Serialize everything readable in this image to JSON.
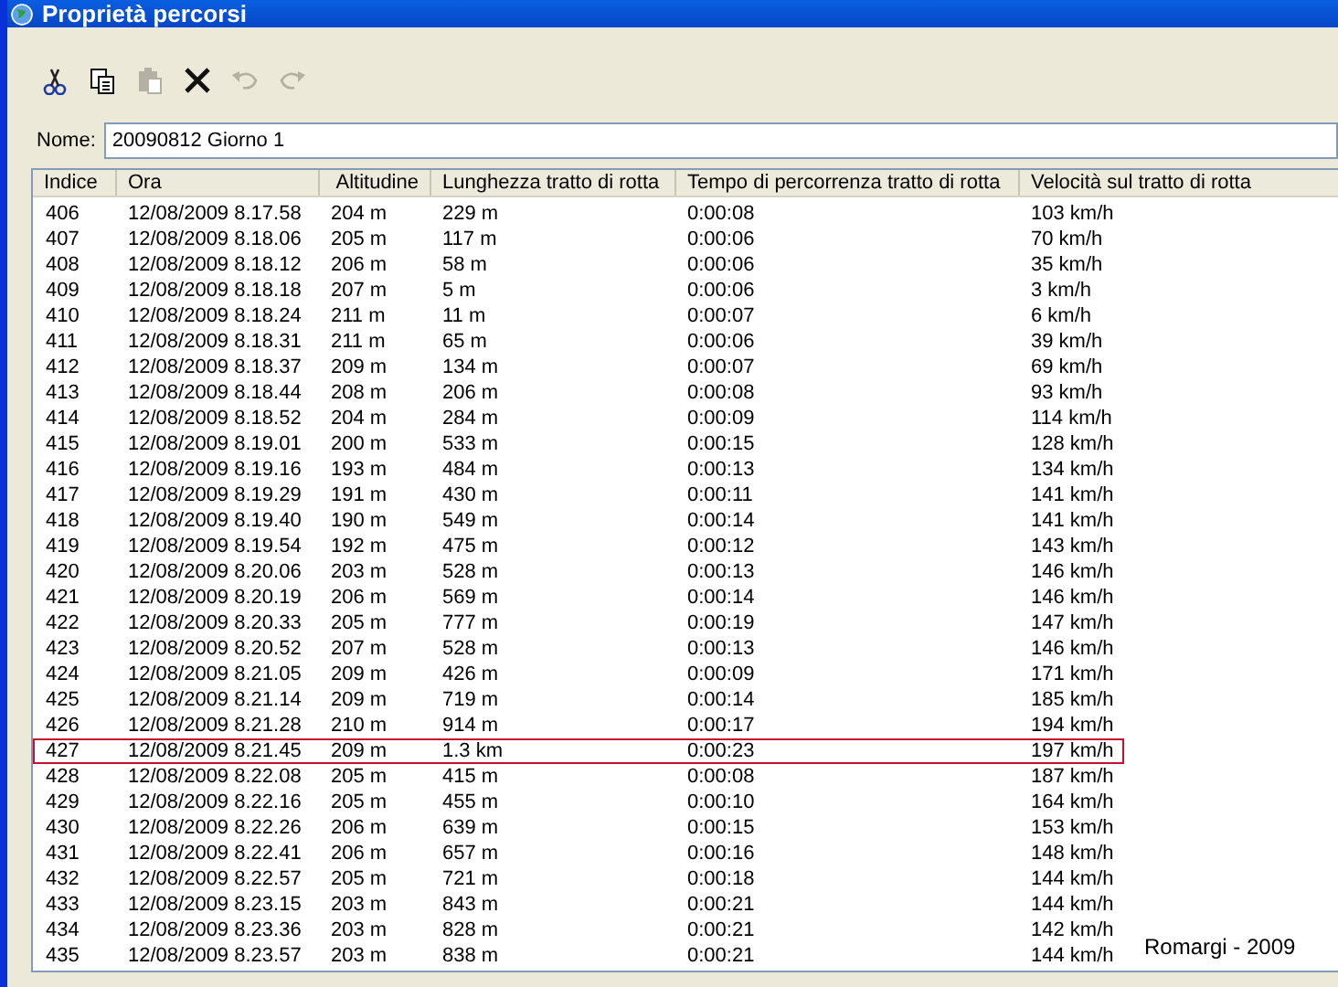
{
  "window": {
    "title": "Proprietà percorsi"
  },
  "toolbar": [
    {
      "kind": "cut",
      "disabled": false
    },
    {
      "kind": "copy",
      "disabled": false
    },
    {
      "kind": "paste",
      "disabled": true
    },
    {
      "kind": "delete",
      "disabled": false
    },
    {
      "kind": "undo",
      "disabled": true
    },
    {
      "kind": "redo",
      "disabled": true
    }
  ],
  "name_field": {
    "label": "Nome:",
    "value": "20090812 Giorno 1"
  },
  "table": {
    "columns": [
      "Indice",
      "Ora",
      "Altitudine",
      "Lunghezza tratto di rotta",
      "Tempo di percorrenza tratto di rotta",
      "Velocità sul tratto di rotta"
    ],
    "rows": [
      {
        "cells": [
          "406",
          "12/08/2009 8.17.58",
          "204 m",
          "229 m",
          "0:00:08",
          "103 km/h"
        ],
        "highlighted": false
      },
      {
        "cells": [
          "407",
          "12/08/2009 8.18.06",
          "205 m",
          "117 m",
          "0:00:06",
          "70 km/h"
        ],
        "highlighted": false
      },
      {
        "cells": [
          "408",
          "12/08/2009 8.18.12",
          "206 m",
          "58 m",
          "0:00:06",
          "35 km/h"
        ],
        "highlighted": false
      },
      {
        "cells": [
          "409",
          "12/08/2009 8.18.18",
          "207 m",
          "5 m",
          "0:00:06",
          "3 km/h"
        ],
        "highlighted": false
      },
      {
        "cells": [
          "410",
          "12/08/2009 8.18.24",
          "211 m",
          "11 m",
          "0:00:07",
          "6 km/h"
        ],
        "highlighted": false
      },
      {
        "cells": [
          "411",
          "12/08/2009 8.18.31",
          "211 m",
          "65 m",
          "0:00:06",
          "39 km/h"
        ],
        "highlighted": false
      },
      {
        "cells": [
          "412",
          "12/08/2009 8.18.37",
          "209 m",
          "134 m",
          "0:00:07",
          "69 km/h"
        ],
        "highlighted": false
      },
      {
        "cells": [
          "413",
          "12/08/2009 8.18.44",
          "208 m",
          "206 m",
          "0:00:08",
          "93 km/h"
        ],
        "highlighted": false
      },
      {
        "cells": [
          "414",
          "12/08/2009 8.18.52",
          "204 m",
          "284 m",
          "0:00:09",
          "114 km/h"
        ],
        "highlighted": false
      },
      {
        "cells": [
          "415",
          "12/08/2009 8.19.01",
          "200 m",
          "533 m",
          "0:00:15",
          "128 km/h"
        ],
        "highlighted": false
      },
      {
        "cells": [
          "416",
          "12/08/2009 8.19.16",
          "193 m",
          "484 m",
          "0:00:13",
          "134 km/h"
        ],
        "highlighted": false
      },
      {
        "cells": [
          "417",
          "12/08/2009 8.19.29",
          "191 m",
          "430 m",
          "0:00:11",
          "141 km/h"
        ],
        "highlighted": false
      },
      {
        "cells": [
          "418",
          "12/08/2009 8.19.40",
          "190 m",
          "549 m",
          "0:00:14",
          "141 km/h"
        ],
        "highlighted": false
      },
      {
        "cells": [
          "419",
          "12/08/2009 8.19.54",
          "192 m",
          "475 m",
          "0:00:12",
          "143 km/h"
        ],
        "highlighted": false
      },
      {
        "cells": [
          "420",
          "12/08/2009 8.20.06",
          "203 m",
          "528 m",
          "0:00:13",
          "146 km/h"
        ],
        "highlighted": false
      },
      {
        "cells": [
          "421",
          "12/08/2009 8.20.19",
          "206 m",
          "569 m",
          "0:00:14",
          "146 km/h"
        ],
        "highlighted": false
      },
      {
        "cells": [
          "422",
          "12/08/2009 8.20.33",
          "205 m",
          "777 m",
          "0:00:19",
          "147 km/h"
        ],
        "highlighted": false
      },
      {
        "cells": [
          "423",
          "12/08/2009 8.20.52",
          "207 m",
          "528 m",
          "0:00:13",
          "146 km/h"
        ],
        "highlighted": false
      },
      {
        "cells": [
          "424",
          "12/08/2009 8.21.05",
          "209 m",
          "426 m",
          "0:00:09",
          "171 km/h"
        ],
        "highlighted": false
      },
      {
        "cells": [
          "425",
          "12/08/2009 8.21.14",
          "209 m",
          "719 m",
          "0:00:14",
          "185 km/h"
        ],
        "highlighted": false
      },
      {
        "cells": [
          "426",
          "12/08/2009 8.21.28",
          "210 m",
          "914 m",
          "0:00:17",
          "194 km/h"
        ],
        "highlighted": false
      },
      {
        "cells": [
          "427",
          "12/08/2009 8.21.45",
          "209 m",
          "1.3 km",
          "0:00:23",
          "197 km/h"
        ],
        "highlighted": true
      },
      {
        "cells": [
          "428",
          "12/08/2009 8.22.08",
          "205 m",
          "415 m",
          "0:00:08",
          "187 km/h"
        ],
        "highlighted": false
      },
      {
        "cells": [
          "429",
          "12/08/2009 8.22.16",
          "205 m",
          "455 m",
          "0:00:10",
          "164 km/h"
        ],
        "highlighted": false
      },
      {
        "cells": [
          "430",
          "12/08/2009 8.22.26",
          "206 m",
          "639 m",
          "0:00:15",
          "153 km/h"
        ],
        "highlighted": false
      },
      {
        "cells": [
          "431",
          "12/08/2009 8.22.41",
          "206 m",
          "657 m",
          "0:00:16",
          "148 km/h"
        ],
        "highlighted": false
      },
      {
        "cells": [
          "432",
          "12/08/2009 8.22.57",
          "205 m",
          "721 m",
          "0:00:18",
          "144 km/h"
        ],
        "highlighted": false
      },
      {
        "cells": [
          "433",
          "12/08/2009 8.23.15",
          "203 m",
          "843 m",
          "0:00:21",
          "144 km/h"
        ],
        "highlighted": false
      },
      {
        "cells": [
          "434",
          "12/08/2009 8.23.36",
          "203 m",
          "828 m",
          "0:00:21",
          "142 km/h"
        ],
        "highlighted": false
      },
      {
        "cells": [
          "435",
          "12/08/2009 8.23.57",
          "203 m",
          "838 m",
          "0:00:21",
          "144 km/h"
        ],
        "highlighted": false
      }
    ]
  },
  "signature": "Romargi - 2009"
}
